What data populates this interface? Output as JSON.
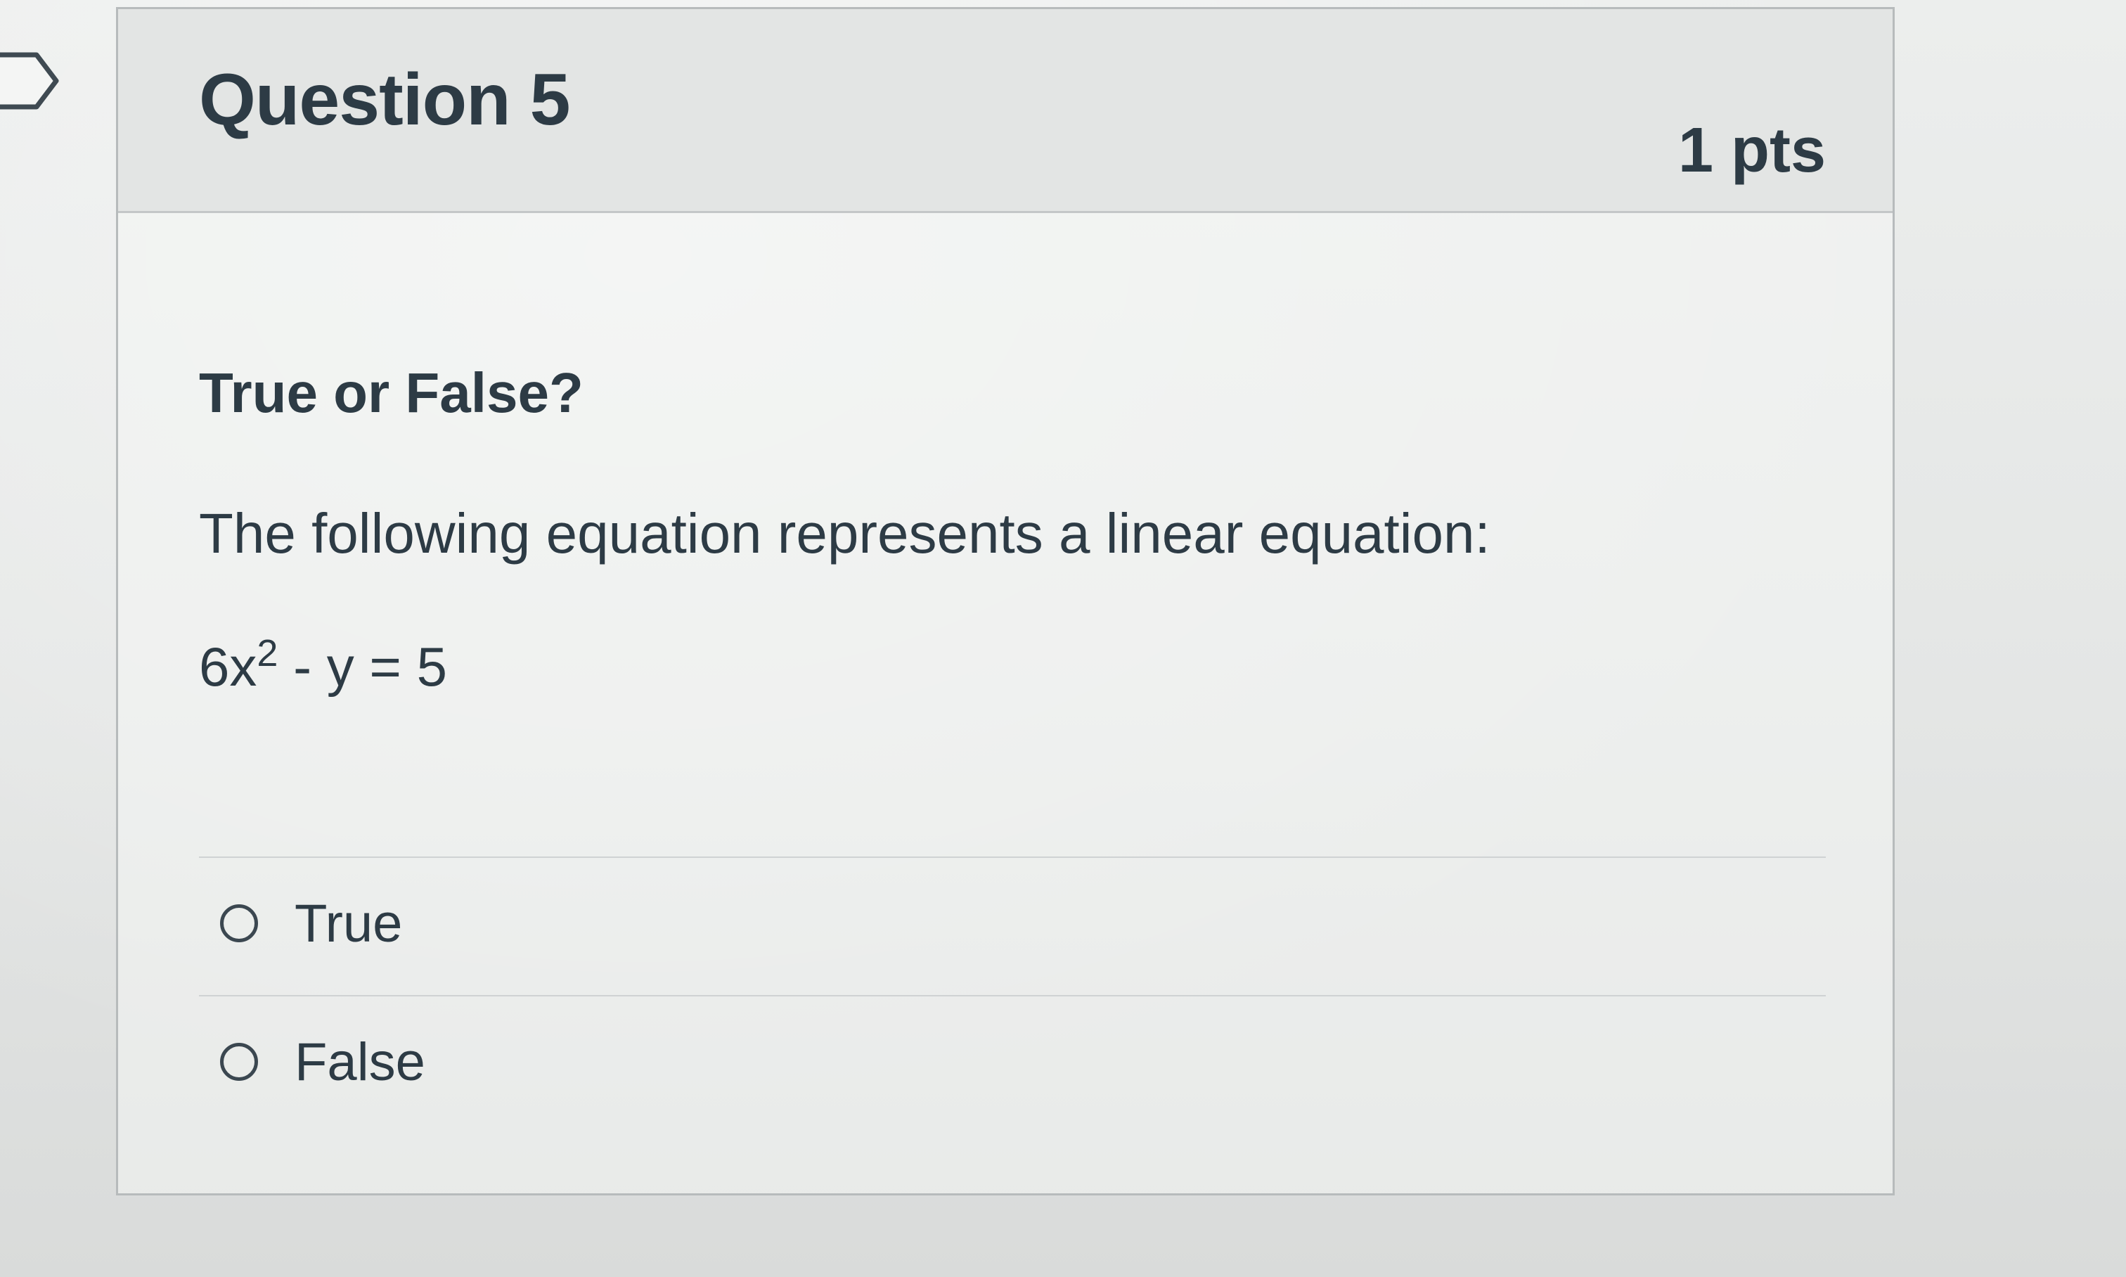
{
  "question": {
    "title": "Question 5",
    "points": "1 pts",
    "prompt_heading": "True or False?",
    "prompt_text": "The following equation represents a linear equation:",
    "equation": {
      "base": "6x",
      "exponent": "2",
      "rest": " - y = 5"
    }
  },
  "answers": [
    {
      "label": "True",
      "selected": false
    },
    {
      "label": "False",
      "selected": false
    }
  ],
  "icons": {
    "flag": "flag-outline-icon",
    "radio": "radio-unchecked-icon"
  },
  "colors": {
    "text": "#2d3b45",
    "header_bg": "#e3e5e4",
    "border": "#b7bbbc"
  }
}
